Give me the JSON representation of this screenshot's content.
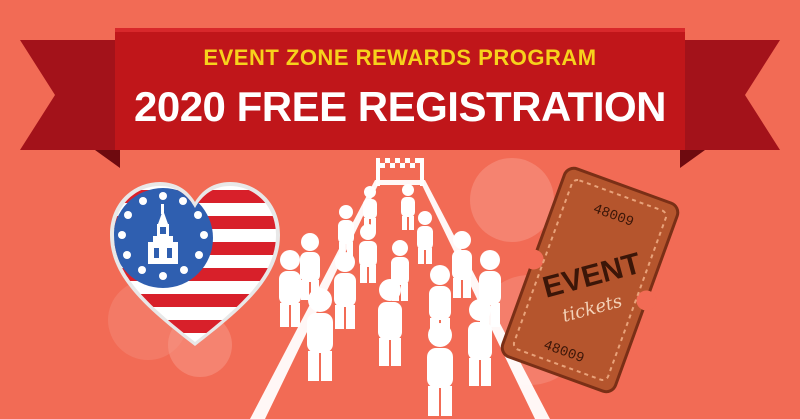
{
  "banner": {
    "subtitle": "EVENT ZONE REWARDS PROGRAM",
    "title": "2020 FREE REGISTRATION"
  },
  "ticket": {
    "number_top": "48009",
    "number_bottom": "48009",
    "word_event": "EVENT",
    "word_tickets": "tickets"
  },
  "icons": {
    "heart": "american-flag-heart-icon",
    "runners": "runners-finish-line-icon",
    "ticket": "event-ticket-icon"
  },
  "colors": {
    "background": "#f26b55",
    "banner_red": "#c0161a",
    "banner_text_yellow": "#f7d21c",
    "ticket_brown": "#b5552d"
  }
}
